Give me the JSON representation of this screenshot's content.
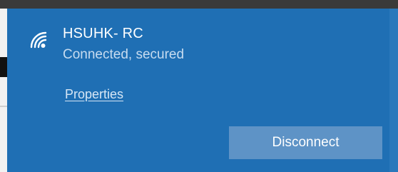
{
  "network": {
    "name": "HSUHK- RC",
    "status": "Connected, secured",
    "icon": "wifi-secured-icon"
  },
  "actions": {
    "properties_label": "Properties",
    "disconnect_label": "Disconnect"
  },
  "colors": {
    "panel_background": "#1f6fb4",
    "button_background": "#5e93c6",
    "status_text": "#c7dcf0",
    "primary_text": "#ffffff"
  }
}
